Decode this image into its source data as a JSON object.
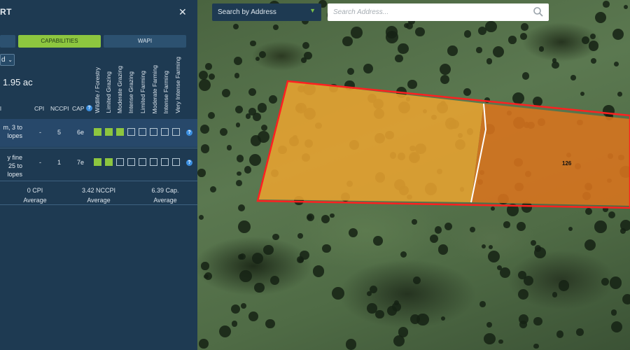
{
  "panel": {
    "title_fragment": "RT",
    "close_icon": "close-icon",
    "tabs": [
      {
        "label": ""
      },
      {
        "label": "CAPABILITIES",
        "active": true
      },
      {
        "label": "WAPI"
      }
    ],
    "view_select_value": "d",
    "acres": "1.95 ac",
    "capability_labels": [
      "Wildlife / Forestry",
      "Limited Grazing",
      "Moderate Grazing",
      "Intense Grazing",
      "Limited Farming",
      "Moderate Farming",
      "Intense Farming",
      "Very Intense Farming"
    ],
    "columns": {
      "first": "l",
      "cpi": "CPI",
      "nccpi": "NCCPI",
      "cap": "CAP"
    },
    "rows": [
      {
        "desc_line1": "m, 3 to",
        "desc_line2": "lopes",
        "cpi": "-",
        "nccpi": "5",
        "cap": "6e",
        "filled": 3
      },
      {
        "desc_line1": "y fine",
        "desc_line2": "25 to",
        "desc_line3": "lopes",
        "cpi": "-",
        "nccpi": "1",
        "cap": "7e",
        "filled": 2
      }
    ],
    "averages": [
      {
        "value": "0 CPI",
        "label": "Average"
      },
      {
        "value": "3.42 NCCPI",
        "label": "Average"
      },
      {
        "value": "6.39 Cap.",
        "label": "Average"
      }
    ]
  },
  "map": {
    "address_select": "Search by Address",
    "search_placeholder": "Search Address...",
    "parcel_label": "126",
    "colors": {
      "parcel_light": "#e8a330",
      "parcel_dark": "#d9741e",
      "outline": "#ff2020",
      "accent": "#8dc63f"
    }
  }
}
